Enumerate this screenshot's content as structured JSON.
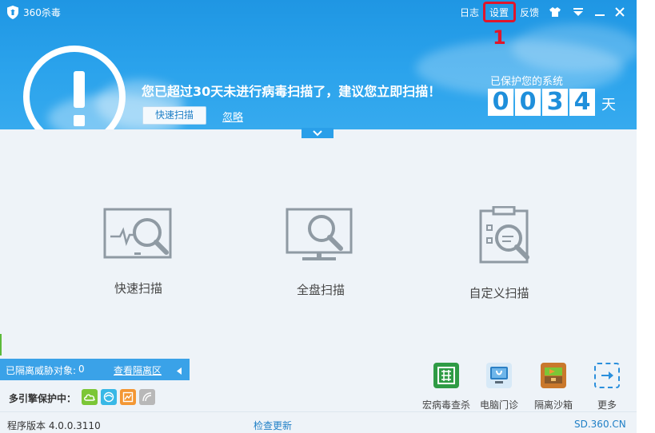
{
  "app": {
    "title": "360杀毒"
  },
  "titlebar": {
    "log": "日志",
    "settings": "设置",
    "feedback": "反馈"
  },
  "annotation": {
    "number": "1",
    "color": "#e0162b"
  },
  "alert": {
    "headline": "您已超过30天未进行病毒扫描了，建议您立即扫描！",
    "quick_scan_button": "快速扫描",
    "ignore_link": "忽略"
  },
  "protection": {
    "label": "已保护您的系统",
    "digits": [
      "0",
      "0",
      "3",
      "4"
    ],
    "unit": "天"
  },
  "scans": [
    {
      "label": "快速扫描",
      "icon": "quick-scan-icon"
    },
    {
      "label": "全盘扫描",
      "icon": "full-scan-icon"
    },
    {
      "label": "自定义扫描",
      "icon": "custom-scan-icon"
    }
  ],
  "quarantine": {
    "label": "已隔离威胁对象:",
    "count": "0",
    "link": "查看隔离区"
  },
  "engines": {
    "label": "多引擎保护中："
  },
  "tools": [
    {
      "label": "宏病毒查杀",
      "icon": "macro-virus-icon"
    },
    {
      "label": "电脑门诊",
      "icon": "pc-clinic-icon"
    },
    {
      "label": "隔离沙箱",
      "icon": "sandbox-icon"
    },
    {
      "label": "更多",
      "icon": "more-icon"
    }
  ],
  "status": {
    "version": "程序版本 4.0.0.3110",
    "check_update": "检查更新",
    "site": "SD.360.CN"
  },
  "colors": {
    "header": "#2ba3ec",
    "accent": "#1f7fc6",
    "quarantine_bar": "#3aa2e8"
  }
}
